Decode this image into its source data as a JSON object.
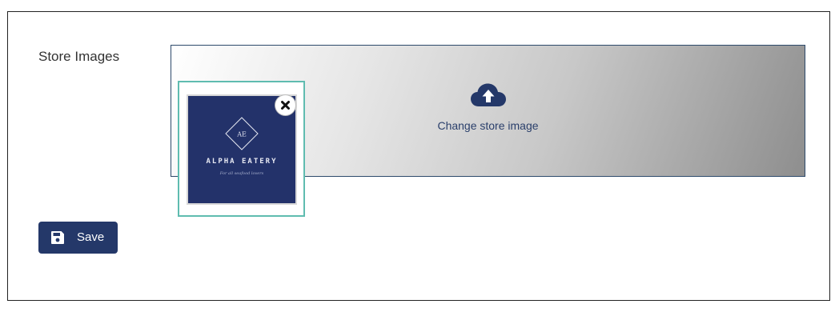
{
  "form": {
    "store_images_label": "Store Images",
    "upload": {
      "label": "Change store image",
      "icon": "cloud-upload-icon"
    },
    "image": {
      "logo_initials": "AE",
      "logo_name": "ALPHA EATERY",
      "logo_tagline": "For all seafood lovers",
      "remove_icon": "close-icon"
    },
    "save": {
      "label": "Save",
      "icon": "floppy-disk-icon"
    }
  },
  "colors": {
    "primary": "#243869",
    "thumb_border": "#5fbcb0",
    "icon": "#243869"
  }
}
